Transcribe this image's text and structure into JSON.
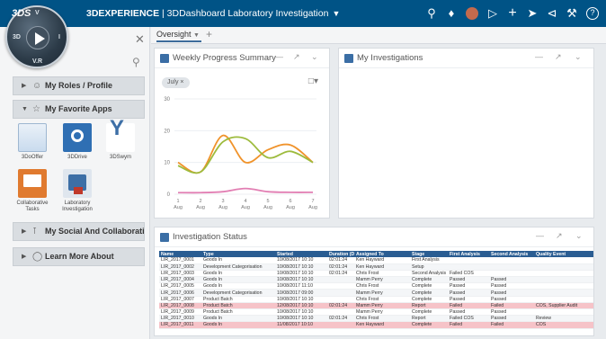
{
  "topbar": {
    "brand": "3DS",
    "title_bold": "3DEXPERIENCE",
    "title_rest": " | 3DDashboard Laboratory Investigation",
    "icons": [
      "search-icon",
      "tag-icon",
      "user-avatar-icon",
      "share-tag-icon",
      "plus-icon",
      "send-icon",
      "share-icon",
      "tools-icon",
      "help-icon"
    ]
  },
  "compass": {
    "north": "V",
    "west": "3D",
    "east": "I",
    "south": "V.R"
  },
  "left_panel": {
    "sections": [
      {
        "label": "My Roles / Profile",
        "expanded": false
      },
      {
        "label": "My Favorite Apps",
        "expanded": true
      },
      {
        "label": "My Social And Collaborativ...",
        "expanded": false
      },
      {
        "label": "Learn More About",
        "expanded": false
      }
    ],
    "apps": [
      {
        "label": "3DoOffer",
        "color": "#5b8fc4"
      },
      {
        "label": "3DDrive",
        "color": "#2f6fb3"
      },
      {
        "label": "3DSwym",
        "color": "#ffffff"
      },
      {
        "label": "Collaborative Tasks",
        "color": "#e07a2f"
      },
      {
        "label": "Laboratory Investigation",
        "color": "#3d6fa6"
      }
    ]
  },
  "tabs": {
    "active": "Oversight",
    "add": "+"
  },
  "weekly_widget": {
    "title": "Weekly Progress Summary",
    "chip": "July",
    "doc_icon": "□"
  },
  "investigations_widget": {
    "title": "My Investigations"
  },
  "status_widget": {
    "title": "Investigation Status",
    "columns": [
      "Name",
      "Type",
      "Started",
      "Duration (D:H:M)",
      "Assigned To",
      "Stage",
      "First Analysis",
      "Second Analysis",
      "Quality Event"
    ],
    "rows": [
      {
        "cells": [
          "LIR_2017_0001",
          "Goods In",
          "10/08/2017 10:10",
          "02:01:24",
          "Ken Hayward",
          "First Analysis",
          "",
          "",
          ""
        ],
        "state": "normal"
      },
      {
        "cells": [
          "LIR_2017_0002",
          "Development Categorisation",
          "10/08/2017 10:10",
          "02:01:24",
          "Ken Hayward",
          "Setup",
          "",
          "",
          ""
        ],
        "state": "alt"
      },
      {
        "cells": [
          "LIR_2017_0003",
          "Goods In",
          "10/08/2017 10:10",
          "02:01:24",
          "Chris Frost",
          "Second Analysis",
          "Failed COS",
          "",
          ""
        ],
        "state": "normal"
      },
      {
        "cells": [
          "LIR_2017_0004",
          "Goods In",
          "10/08/2017 10:10",
          "",
          "Mamm Perry",
          "Complete",
          "Passed",
          "Passed",
          ""
        ],
        "state": "alt"
      },
      {
        "cells": [
          "LIR_2017_0005",
          "Goods In",
          "10/08/2017 11:10",
          "",
          "Chris Frost",
          "Complete",
          "Passed",
          "Passed",
          ""
        ],
        "state": "normal"
      },
      {
        "cells": [
          "LIR_2017_0006",
          "Development Categorisation",
          "10/08/2017 09:00",
          "",
          "Mamm Perry",
          "Complete",
          "Passed",
          "Passed",
          ""
        ],
        "state": "alt"
      },
      {
        "cells": [
          "LIR_2017_0007",
          "Product Batch",
          "10/08/2017 10:10",
          "",
          "Chris Frost",
          "Complete",
          "Passed",
          "Passed",
          ""
        ],
        "state": "normal"
      },
      {
        "cells": [
          "LIR_2017_0008",
          "Product Batch",
          "12/08/2017 10:10",
          "02:01:24",
          "Mamm Perry",
          "Report",
          "Failed",
          "Failed",
          "COS, Supplier Audit"
        ],
        "state": "fail"
      },
      {
        "cells": [
          "LIR_2017_0009",
          "Product Batch",
          "10/08/2017 10:10",
          "",
          "Mamm Perry",
          "Complete",
          "Passed",
          "Passed",
          ""
        ],
        "state": "normal"
      },
      {
        "cells": [
          "LIR_2017_0010",
          "Goods In",
          "10/08/2017 10:10",
          "02:01:24",
          "Chris Frost",
          "Report",
          "Failed COS",
          "Passed",
          "Review"
        ],
        "state": "alt"
      },
      {
        "cells": [
          "LIR_2017_0011",
          "Goods In",
          "11/08/2017 10:10",
          "",
          "Ken Hayward",
          "Complete",
          "Failed",
          "Failed",
          "COS"
        ],
        "state": "fail"
      }
    ]
  },
  "chart_data": {
    "type": "line",
    "title": "",
    "xlabel": "",
    "ylabel": "",
    "categories": [
      "1 Aug",
      "2 Aug",
      "3 Aug",
      "4 Aug",
      "5 Aug",
      "6 Aug",
      "7 Aug"
    ],
    "ylim": [
      0,
      30
    ],
    "yticks": [
      0,
      10,
      20,
      30
    ],
    "grid": true,
    "series": [
      {
        "values": [
          10,
          7,
          18.5,
          10,
          14,
          15.5,
          10
        ],
        "color": "#f0932b"
      },
      {
        "values": [
          9,
          7,
          16.5,
          17.5,
          11.5,
          13.5,
          10
        ],
        "color": "#9dbb3d"
      },
      {
        "values": [
          0.5,
          0.5,
          0.8,
          1.8,
          0.8,
          0.6,
          0.6
        ],
        "color": "#e27fb3"
      }
    ]
  }
}
